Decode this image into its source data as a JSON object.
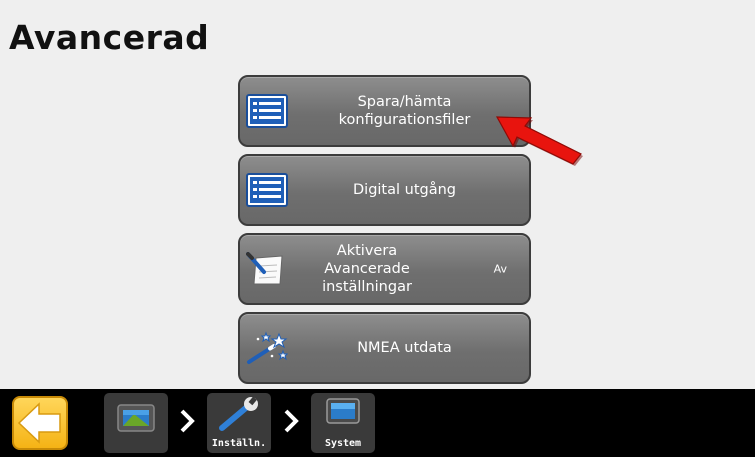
{
  "page": {
    "title": "Avancerad"
  },
  "menu": [
    {
      "id": "save-load",
      "label": "Spara/hämta\nkonfigurationsfiler",
      "icon": "list-icon"
    },
    {
      "id": "digital-output",
      "label": "Digital utgång",
      "icon": "list-icon"
    },
    {
      "id": "advanced-settings",
      "label": "Aktivera\nAvancerade\ninställningar",
      "icon": "notepad-pen-icon",
      "state": "Av"
    },
    {
      "id": "nmea",
      "label": "NMEA utdata",
      "icon": "magic-wand-icon"
    }
  ],
  "breadcrumb": [
    {
      "label": "",
      "icon": "display-terminal-icon"
    },
    {
      "label": "Inställn.",
      "icon": "wrench-icon"
    },
    {
      "label": "System",
      "icon": "monitor-icon"
    }
  ],
  "colors": {
    "arrow": "#e8140e",
    "back_button": "#f5b315",
    "bar": "#000000"
  }
}
